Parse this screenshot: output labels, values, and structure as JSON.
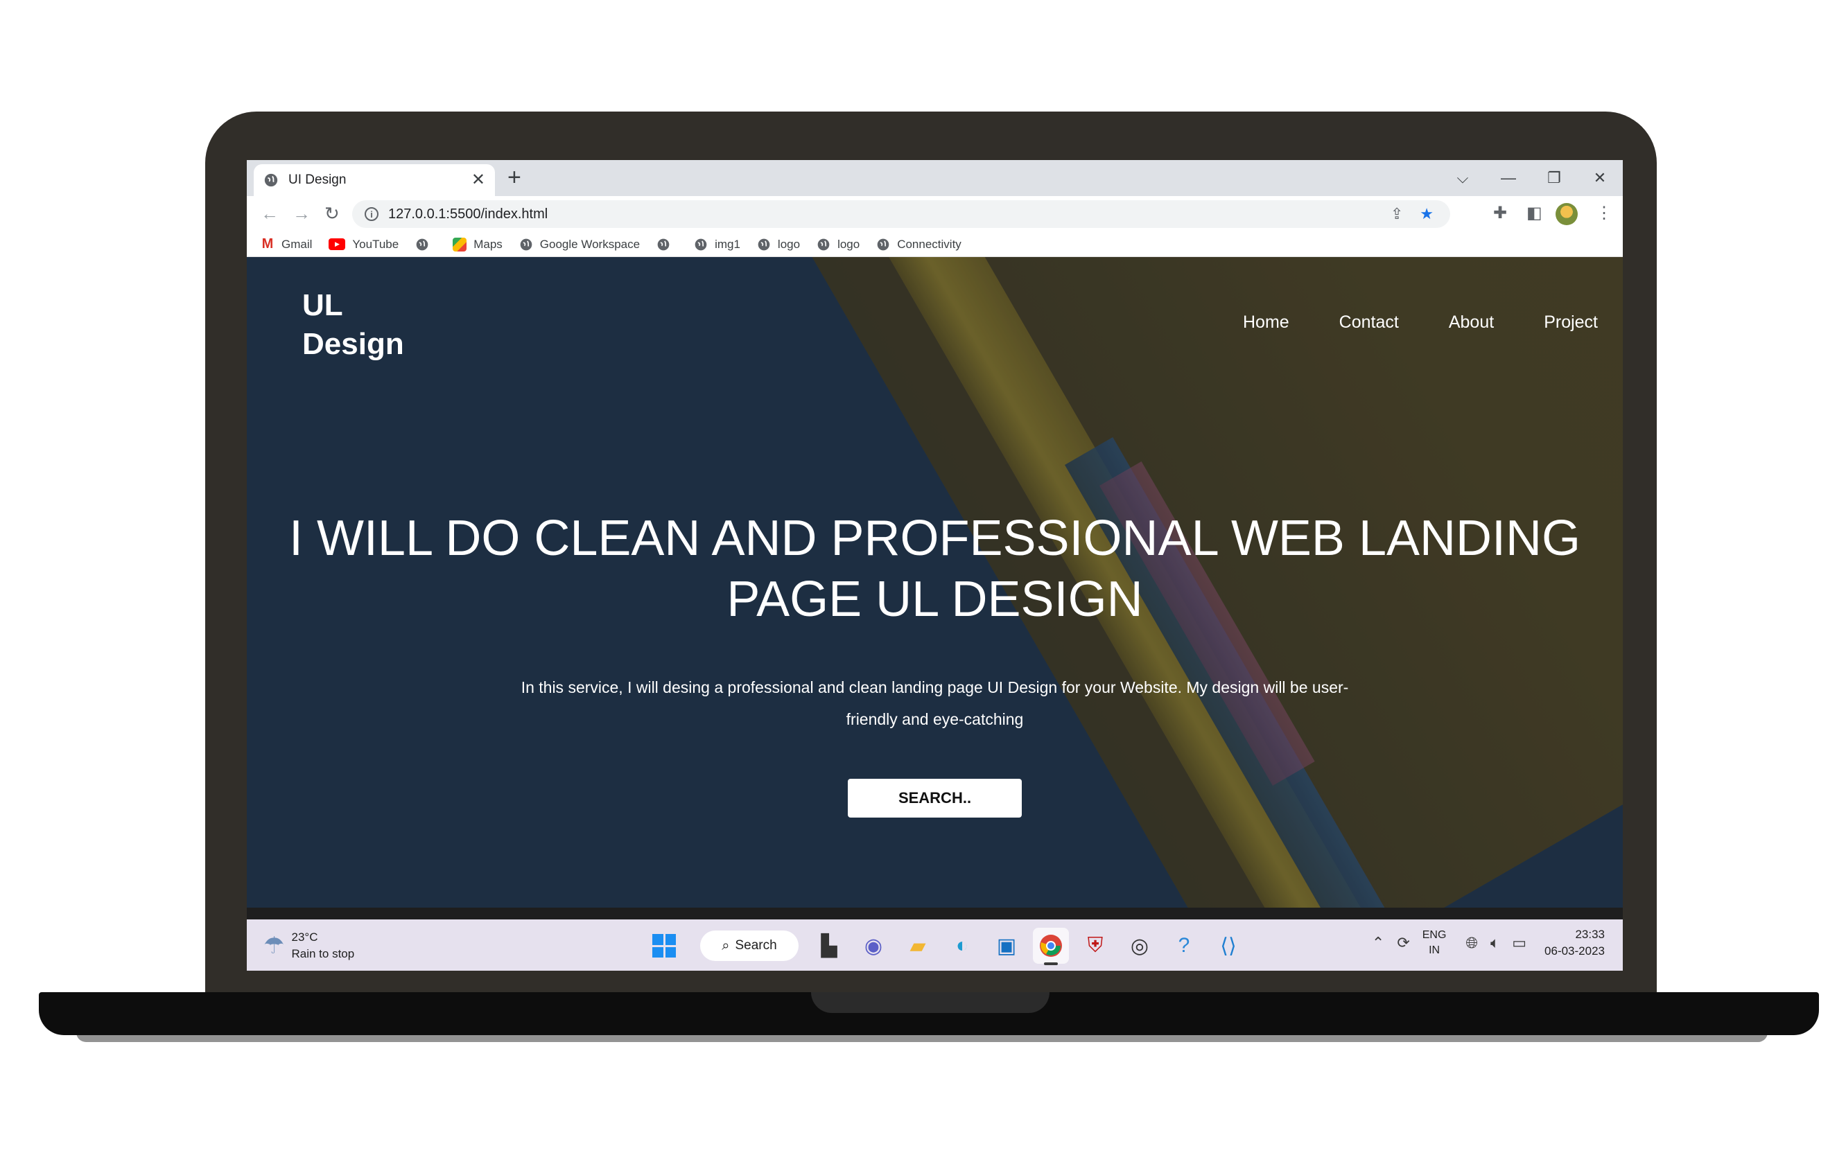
{
  "browser": {
    "tab_title": "UI Design",
    "tab_close": "✕",
    "new_tab": "+",
    "url": "127.0.0.1:5500/index.html",
    "window_controls": {
      "dropdown": "⌵",
      "minimize": "—",
      "restore": "❐",
      "close": "✕"
    },
    "bookmarks": [
      {
        "label": "Gmail",
        "icon": "gmail-icon"
      },
      {
        "label": "YouTube",
        "icon": "youtube-icon"
      },
      {
        "label": "",
        "icon": "globe-icon"
      },
      {
        "label": "Maps",
        "icon": "maps-icon"
      },
      {
        "label": "Google Workspace",
        "icon": "globe-icon"
      },
      {
        "label": "",
        "icon": "globe-icon"
      },
      {
        "label": "img1",
        "icon": "globe-icon"
      },
      {
        "label": "logo",
        "icon": "globe-icon"
      },
      {
        "label": "logo",
        "icon": "globe-icon"
      },
      {
        "label": "Connectivity",
        "icon": "globe-icon"
      }
    ]
  },
  "page": {
    "logo": "UL Design",
    "nav": [
      "Home",
      "Contact",
      "About",
      "Project"
    ],
    "headline": "I WILL DO CLEAN AND PROFESSIONAL WEB LANDING PAGE UL DESIGN",
    "subtext": "In this service, I will desing a professional and clean landing page UI Design for your Website. My design will be user-friendly and eye-catching",
    "button": "SEARCH.."
  },
  "taskbar": {
    "temperature": "23°C",
    "weather": "Rain to stop",
    "search_label": "Search",
    "lang_top": "ENG",
    "lang_bottom": "IN",
    "time": "23:33",
    "date": "06-03-2023"
  },
  "colors": {
    "hero_blue": "#203349",
    "hero_olive": "#4a4124",
    "laptop_frame": "#312e29",
    "accent_blue": "#1a73e8"
  }
}
